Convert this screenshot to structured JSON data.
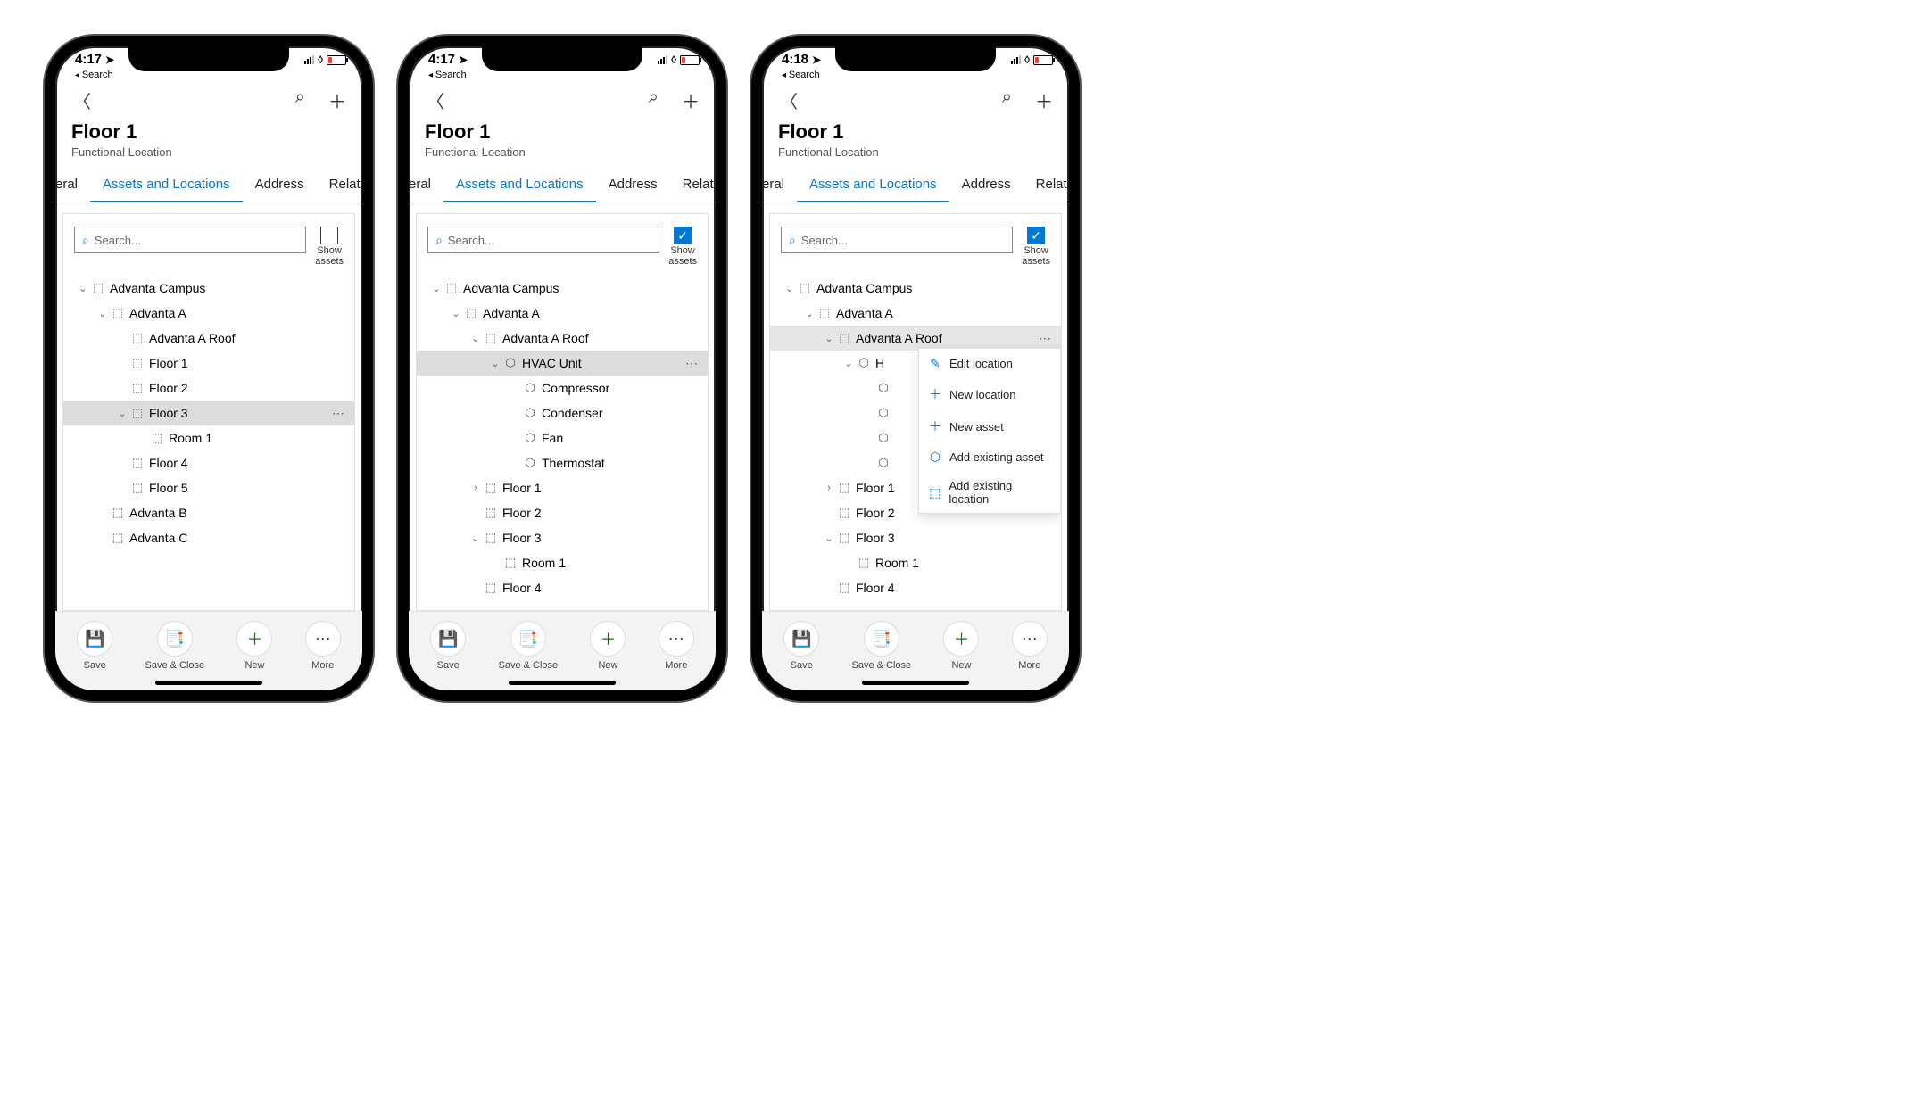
{
  "status": {
    "time_a": "4:17",
    "time_b": "4:18",
    "back_label": "Search"
  },
  "header": {
    "title": "Floor 1",
    "subtitle": "Functional Location"
  },
  "tabs": {
    "t0_partial": "eral",
    "t1": "Assets and Locations",
    "t2": "Address",
    "t3_partial": "Relate"
  },
  "search": {
    "placeholder": "Search...",
    "show_label1": "Show",
    "show_label2": "assets"
  },
  "tree1": {
    "n0": "Advanta Campus",
    "n1": "Advanta A",
    "n2": "Advanta A Roof",
    "n3": "Floor 1",
    "n4": "Floor 2",
    "n5": "Floor 3",
    "n6": "Room 1",
    "n7": "Floor 4",
    "n8": "Floor 5",
    "n9": "Advanta B",
    "n10": "Advanta C"
  },
  "tree2": {
    "n0": "Advanta Campus",
    "n1": "Advanta A",
    "n2": "Advanta A Roof",
    "n3": "HVAC Unit",
    "n4": "Compressor",
    "n5": "Condenser",
    "n6": "Fan",
    "n7": "Thermostat",
    "n8": "Floor 1",
    "n9": "Floor 2",
    "n10": "Floor 3",
    "n11": "Room 1",
    "n12": "Floor 4"
  },
  "tree3": {
    "n0": "Advanta Campus",
    "n1": "Advanta A",
    "n2": "Advanta A Roof",
    "n3": "H",
    "n8": "Floor 1",
    "n9": "Floor 2",
    "n10": "Floor 3",
    "n11": "Room 1",
    "n12": "Floor 4"
  },
  "ctx": {
    "i0": "Edit location",
    "i1": "New location",
    "i2": "New asset",
    "i3": "Add existing asset",
    "i4": "Add existing location"
  },
  "bottom": {
    "b0": "Save",
    "b1": "Save & Close",
    "b2": "New",
    "b3": "More"
  }
}
